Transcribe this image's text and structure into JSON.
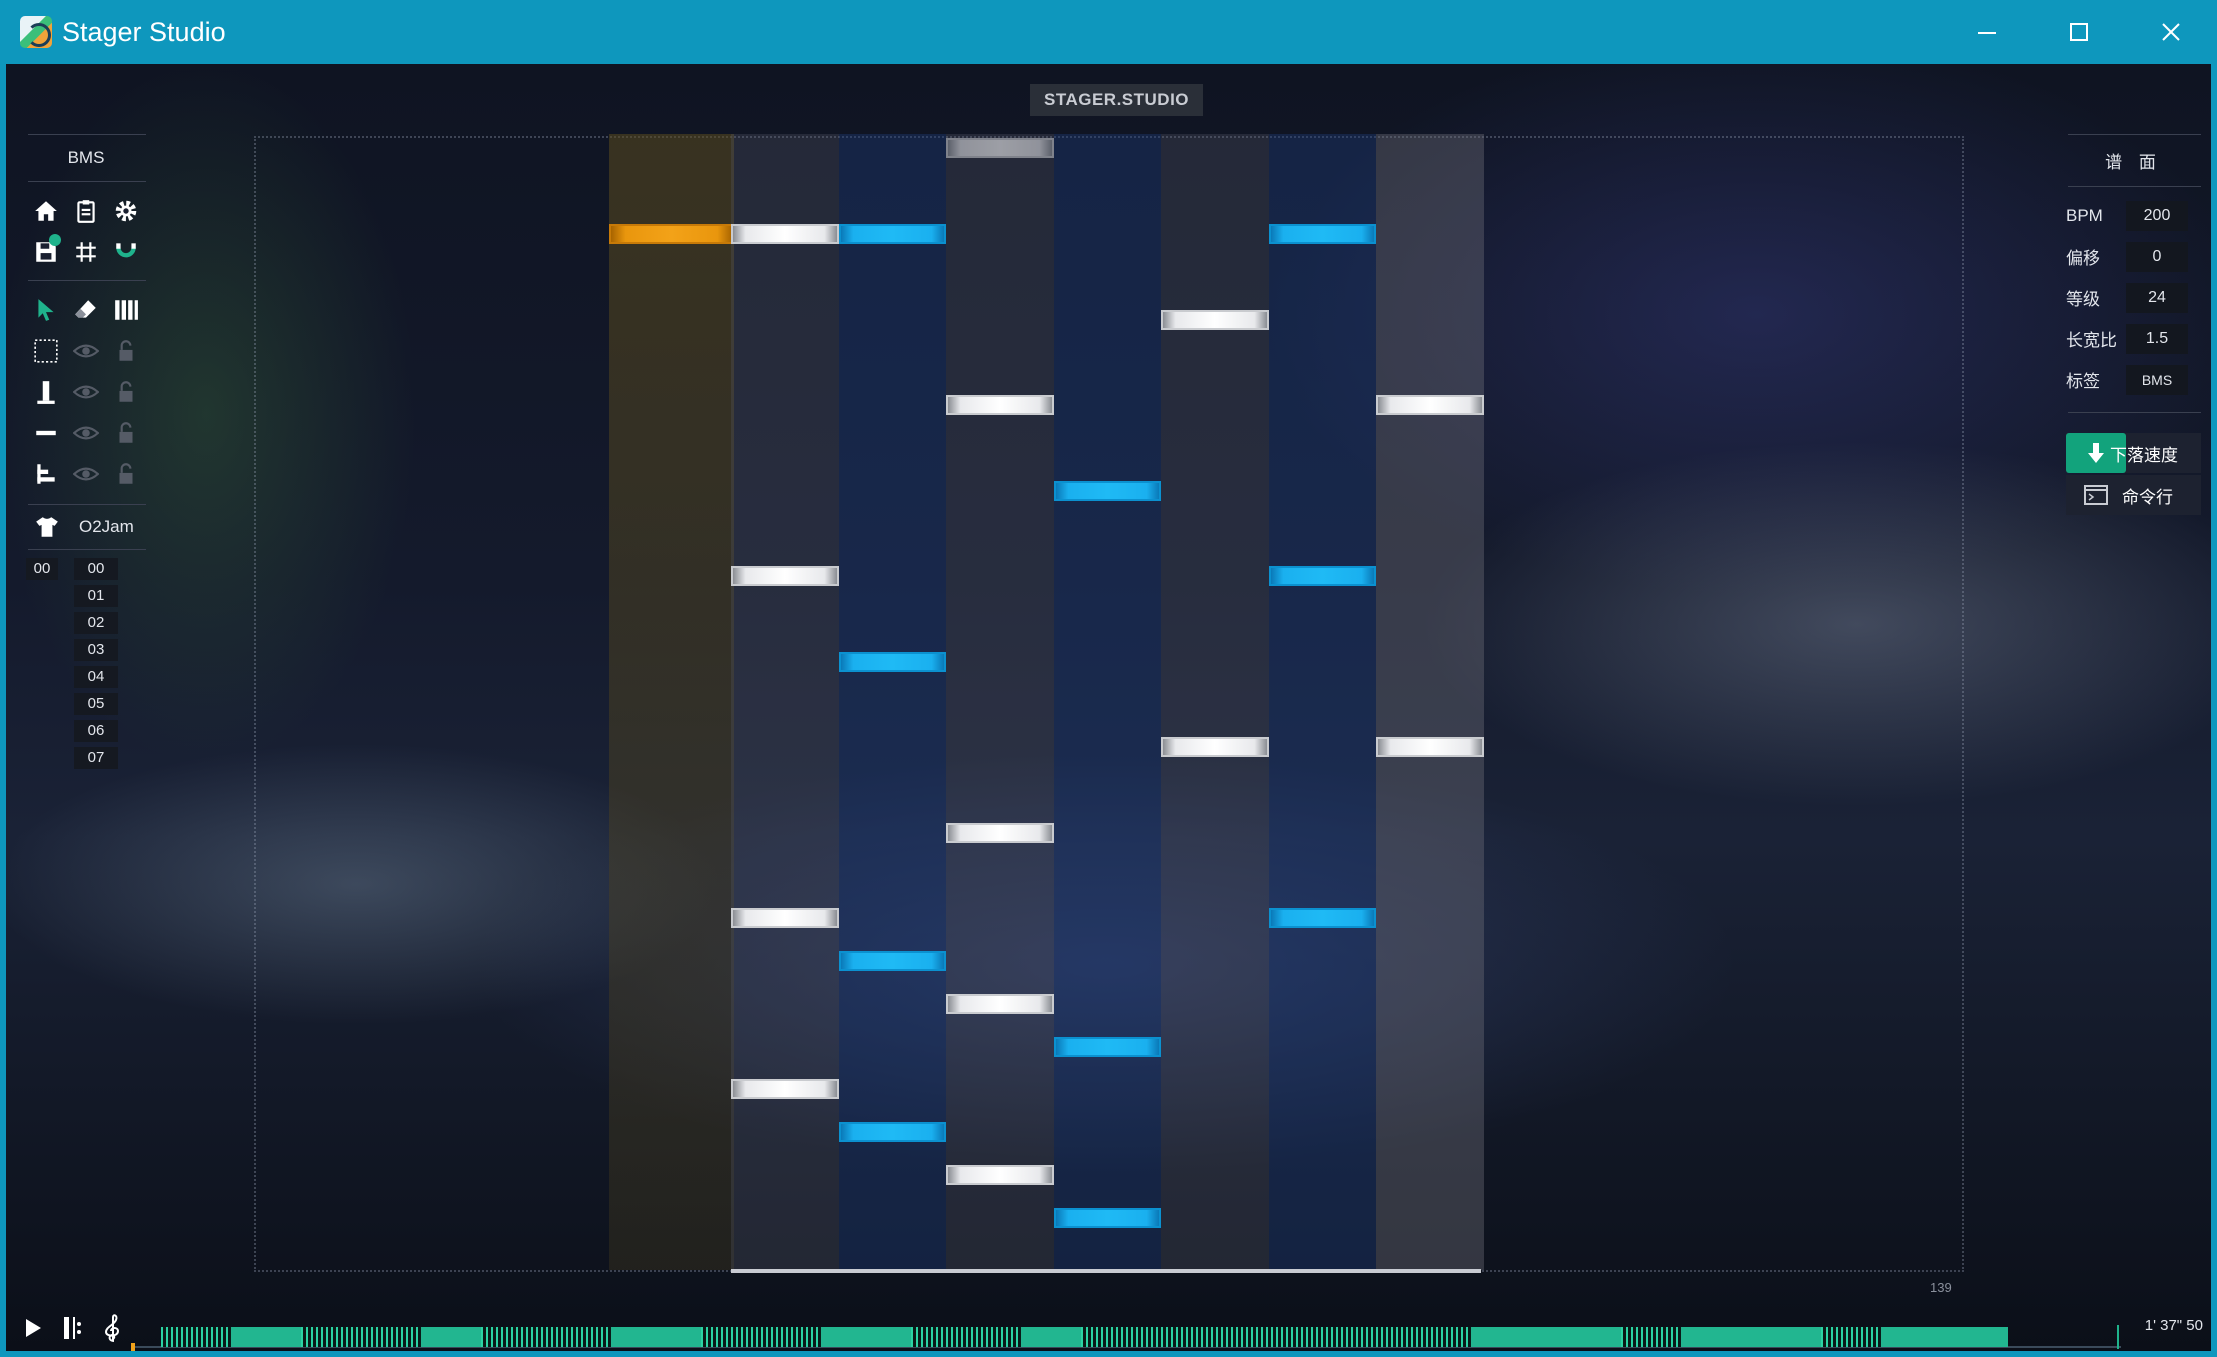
{
  "window": {
    "title": "Stager Studio",
    "minimize_glyph": "─",
    "close_glyph": "✕"
  },
  "stage": {
    "watermark": "STAGER.STUDIO",
    "frame_count": "139"
  },
  "left_panel": {
    "format_label": "BMS",
    "toolbar_icons": [
      "home-icon",
      "clipboard-icon",
      "gear-icon",
      "save-icon",
      "grid-icon",
      "magnet-icon"
    ],
    "tool_icons": [
      "select-arrow-icon",
      "eraser-icon",
      "columns-icon"
    ],
    "layer_rows": [
      "stage-layer",
      "track-layer",
      "note-layer",
      "timing-layer"
    ],
    "skin_label": "O2Jam",
    "container_id": "00",
    "layer_ids": [
      "00",
      "01",
      "02",
      "03",
      "04",
      "05",
      "06",
      "07"
    ]
  },
  "right_panel": {
    "title": "谱 面",
    "properties": [
      {
        "label": "BPM",
        "value": "200"
      },
      {
        "label": "偏移",
        "value": "0"
      },
      {
        "label": "等级",
        "value": "24"
      },
      {
        "label": "长宽比",
        "value": "1.5"
      },
      {
        "label": "标签",
        "value": "BMS"
      }
    ],
    "actions": [
      {
        "label": "下落速度",
        "icon": "arrow-down-icon",
        "active": true
      },
      {
        "label": "命令行",
        "icon": "terminal-icon",
        "active": false
      }
    ]
  },
  "bottom_bar": {
    "play_icon": "play-icon",
    "step_icon": "step-icon",
    "music_icon": "treble-clef-icon",
    "time": "1' 37\" 50",
    "progress": 0.0
  },
  "colors": {
    "titlebar": "#0e97bd",
    "accent_green": "#22b690",
    "note_blue": "#1fbaf5",
    "note_white": "#ffffff",
    "note_orange": "#f3a218"
  }
}
